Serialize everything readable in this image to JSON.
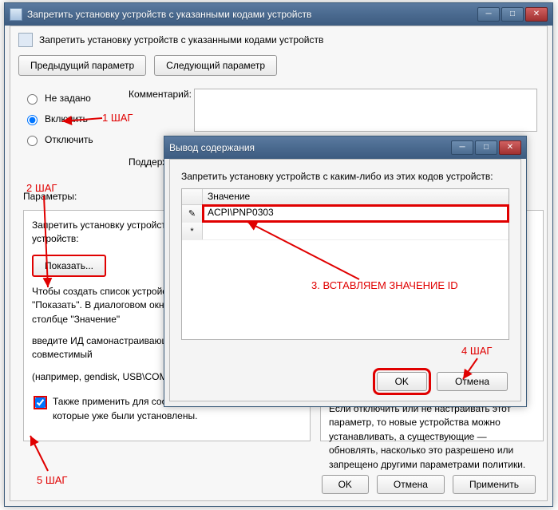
{
  "main": {
    "title": "Запретить установку устройств с указанными кодами устройств",
    "header_text": "Запретить установку устройств с указанными кодами устройств",
    "prev_btn": "Предыдущий параметр",
    "next_btn": "Следующий параметр",
    "radio_not_set": "Не задано",
    "radio_enable": "Включить",
    "radio_disable": "Отключить",
    "comment_label": "Комментарий:",
    "support_label": "Поддерживается:",
    "params_label": "Параметры:",
    "left_panel": {
      "line1": "Запретить установку устройств с каким-либо из этих кодов устройств:",
      "show_btn": "Показать...",
      "line2": "Чтобы создать список устройств, нажмите команду \"Показать\". В диалоговом окне \"Вывод содержания\" в столбце \"Значение\"",
      "line3": "введите ИД самонастраивающегося оборудования или совместимый",
      "line4": "(например, gendisk, USB\\COMPOSITE, USB\\Class_ff)",
      "checkbox_label": "Также применить для соответствующих устройств, которые уже были установлены."
    },
    "right_panel_text": "Если отключить или не настраивать этот параметр, то новые устройства можно устанавливать, а существующие — обновлять, насколько это разрешено или запрещено другими параметрами политики.",
    "ok_btn": "OK",
    "cancel_btn": "Отмена",
    "apply_btn": "Применить"
  },
  "dialog": {
    "title": "Вывод содержания",
    "prompt": "Запретить установку устройств с каким-либо из этих кодов устройств:",
    "col_header": "Значение",
    "row_marker_edit": "✎",
    "row_marker_new": "*",
    "value1": "ACPI\\PNP0303",
    "ok_btn": "OK",
    "cancel_btn": "Отмена"
  },
  "annotations": {
    "step1": "1 ШАГ",
    "step2": "2 ШАГ",
    "step3": "3. ВСТАВЛЯЕМ ЗНАЧЕНИЕ ID",
    "step4": "4 ШАГ",
    "step5": "5 ШАГ"
  }
}
